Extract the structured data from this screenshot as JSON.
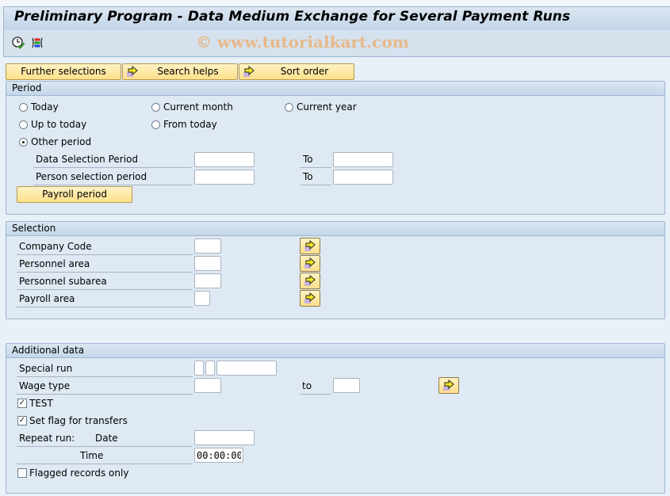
{
  "window": {
    "title": "Preliminary Program - Data Medium Exchange for Several Payment Runs",
    "watermark": "© www.tutorialkart.com"
  },
  "toolbar": {
    "icons": [
      "execute-clock-icon",
      "selection-options-icon"
    ]
  },
  "tabs": [
    {
      "label": "Further selections",
      "icon": null
    },
    {
      "label": "Search helps",
      "icon": "arrow-right-icon"
    },
    {
      "label": "Sort order",
      "icon": "arrow-right-icon"
    }
  ],
  "period": {
    "title": "Period",
    "radios": [
      {
        "label": "Today",
        "checked": false
      },
      {
        "label": "Current month",
        "checked": false
      },
      {
        "label": "Current year",
        "checked": false
      },
      {
        "label": "Up to today",
        "checked": false
      },
      {
        "label": "From today",
        "checked": false
      },
      {
        "label": "Other period",
        "checked": true
      }
    ],
    "fields": [
      {
        "label": "Data Selection Period",
        "from": "",
        "to_label": "To",
        "to": ""
      },
      {
        "label": "Person selection period",
        "from": "",
        "to_label": "To",
        "to": ""
      }
    ],
    "payroll_button": "Payroll period"
  },
  "selection": {
    "title": "Selection",
    "fields": [
      {
        "label": "Company Code",
        "value": ""
      },
      {
        "label": "Personnel area",
        "value": ""
      },
      {
        "label": "Personnel subarea",
        "value": ""
      },
      {
        "label": "Payroll area",
        "value": ""
      }
    ]
  },
  "additional": {
    "title": "Additional data",
    "special_run_label": "Special run",
    "special_run_values": [
      "",
      "",
      ""
    ],
    "wage_type_label": "Wage type",
    "wage_type_from": "",
    "wage_type_to_label": "to",
    "wage_type_to": "",
    "test_label": "TEST",
    "test_checked": true,
    "set_flag_label": "Set flag for transfers",
    "set_flag_checked": true,
    "repeat_run_label": "Repeat run:",
    "date_label": "Date",
    "date_value": "",
    "time_label": "Time",
    "time_value": "00:00:00",
    "flagged_label": "Flagged records only",
    "flagged_checked": false
  }
}
